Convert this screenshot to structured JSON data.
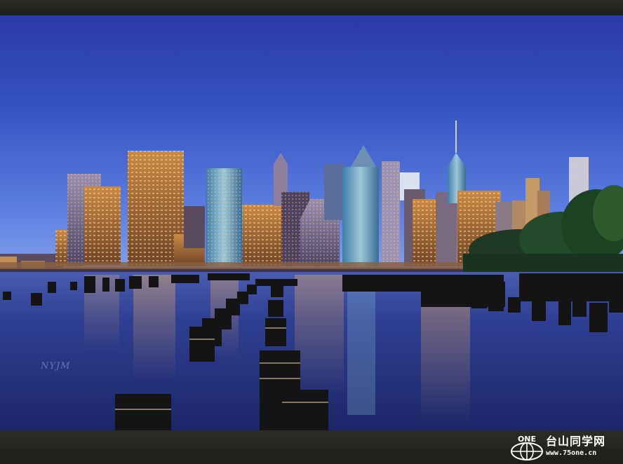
{
  "photo": {
    "subject": "Lower Manhattan skyline at dusk with old pier pilings in the foreground",
    "signature": "NYJM"
  },
  "watermark": {
    "emblem_text": "ONE",
    "site_name": "台山同学网",
    "site_url": "www.75one.cn"
  },
  "colors": {
    "frame": "#23251f",
    "sky_top": "#2c3fa8",
    "sky_horizon": "#6f8fe4",
    "water": "#2b3b86",
    "city_lights": "#f2a64a"
  }
}
